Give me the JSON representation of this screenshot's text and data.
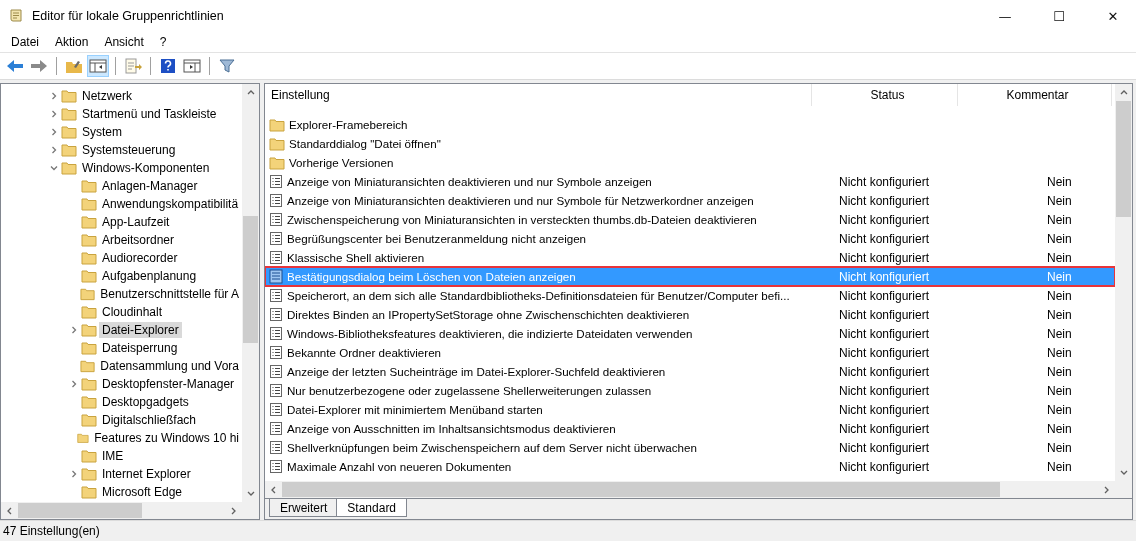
{
  "window": {
    "title": "Editor für lokale Gruppenrichtlinien",
    "controls": [
      "—",
      "☐",
      "✕"
    ]
  },
  "menu": [
    "Datei",
    "Aktion",
    "Ansicht",
    "?"
  ],
  "toolbar": [
    {
      "kind": "back",
      "pressed": false
    },
    {
      "kind": "forward",
      "pressed": false
    },
    {
      "kind": "sep"
    },
    {
      "kind": "folder-up",
      "pressed": false
    },
    {
      "kind": "tree-pane",
      "pressed": true
    },
    {
      "kind": "sep"
    },
    {
      "kind": "export",
      "pressed": false
    },
    {
      "kind": "sep"
    },
    {
      "kind": "help",
      "pressed": false
    },
    {
      "kind": "console",
      "pressed": false
    },
    {
      "kind": "sep"
    },
    {
      "kind": "filter",
      "pressed": false
    }
  ],
  "tree": [
    {
      "label": "Netzwerk",
      "has_children": true,
      "expanded": false,
      "selected": false
    },
    {
      "label": "Startmenü und Taskleiste",
      "has_children": true,
      "expanded": false,
      "selected": false
    },
    {
      "label": "System",
      "has_children": true,
      "expanded": false,
      "selected": false
    },
    {
      "label": "Systemsteuerung",
      "has_children": true,
      "expanded": false,
      "selected": false
    },
    {
      "label": "Windows-Komponenten",
      "has_children": true,
      "expanded": true,
      "selected": false,
      "children": [
        {
          "label": "Anlagen-Manager",
          "has_children": false,
          "selected": false
        },
        {
          "label": "Anwendungskompatibilitä",
          "has_children": false,
          "selected": false
        },
        {
          "label": "App-Laufzeit",
          "has_children": false,
          "selected": false
        },
        {
          "label": "Arbeitsordner",
          "has_children": false,
          "selected": false
        },
        {
          "label": "Audiorecorder",
          "has_children": false,
          "selected": false
        },
        {
          "label": "Aufgabenplanung",
          "has_children": false,
          "selected": false
        },
        {
          "label": "Benutzerschnittstelle für A",
          "has_children": false,
          "selected": false
        },
        {
          "label": "Cloudinhalt",
          "has_children": false,
          "selected": false
        },
        {
          "label": "Datei-Explorer",
          "has_children": true,
          "expanded": false,
          "selected": true
        },
        {
          "label": "Dateisperrung",
          "has_children": false,
          "selected": false
        },
        {
          "label": "Datensammlung und Vora",
          "has_children": false,
          "selected": false
        },
        {
          "label": "Desktopfenster-Manager",
          "has_children": true,
          "expanded": false,
          "selected": false
        },
        {
          "label": "Desktopgadgets",
          "has_children": false,
          "selected": false
        },
        {
          "label": "Digitalschließfach",
          "has_children": false,
          "selected": false
        },
        {
          "label": "Features zu Windows 10 hi",
          "has_children": false,
          "selected": false
        },
        {
          "label": "IME",
          "has_children": false,
          "selected": false
        },
        {
          "label": "Internet Explorer",
          "has_children": true,
          "expanded": false,
          "selected": false
        },
        {
          "label": "Microsoft Edge",
          "has_children": false,
          "selected": false
        }
      ]
    }
  ],
  "table": {
    "columns": [
      "Einstellung",
      "Status",
      "Kommentar"
    ],
    "rows": [
      {
        "kind": "folder",
        "name": "Explorer-Framebereich",
        "selected": false
      },
      {
        "kind": "folder",
        "name": "Standarddialog \"Datei öffnen\"",
        "selected": false
      },
      {
        "kind": "folder",
        "name": "Vorherige Versionen",
        "selected": false
      },
      {
        "kind": "setting",
        "name": "Anzeige von Miniaturansichten deaktivieren und nur Symbole anzeigen",
        "status": "Nicht konfiguriert",
        "comment": "Nein",
        "selected": false
      },
      {
        "kind": "setting",
        "name": "Anzeige von Miniaturansichten deaktivieren und nur Symbole für Netzwerkordner anzeigen",
        "status": "Nicht konfiguriert",
        "comment": "Nein",
        "selected": false
      },
      {
        "kind": "setting",
        "name": "Zwischenspeicherung von Miniaturansichten in versteckten thumbs.db-Dateien deaktivieren",
        "status": "Nicht konfiguriert",
        "comment": "Nein",
        "selected": false
      },
      {
        "kind": "setting",
        "name": "Begrüßungscenter bei Benutzeranmeldung nicht anzeigen",
        "status": "Nicht konfiguriert",
        "comment": "Nein",
        "selected": false
      },
      {
        "kind": "setting",
        "name": "Klassische Shell aktivieren",
        "status": "Nicht konfiguriert",
        "comment": "Nein",
        "selected": false
      },
      {
        "kind": "setting",
        "name": "Bestätigungsdialog beim Löschen von Dateien anzeigen",
        "status": "Nicht konfiguriert",
        "comment": "Nein",
        "selected": true
      },
      {
        "kind": "setting",
        "name": "Speicherort, an dem sich alle Standardbibliotheks-Definitionsdateien für Benutzer/Computer befi...",
        "status": "Nicht konfiguriert",
        "comment": "Nein",
        "selected": false
      },
      {
        "kind": "setting",
        "name": "Direktes Binden an IPropertySetStorage ohne Zwischenschichten deaktivieren",
        "status": "Nicht konfiguriert",
        "comment": "Nein",
        "selected": false
      },
      {
        "kind": "setting",
        "name": "Windows-Bibliotheksfeatures deaktivieren, die indizierte Dateidaten verwenden",
        "status": "Nicht konfiguriert",
        "comment": "Nein",
        "selected": false
      },
      {
        "kind": "setting",
        "name": "Bekannte Ordner deaktivieren",
        "status": "Nicht konfiguriert",
        "comment": "Nein",
        "selected": false
      },
      {
        "kind": "setting",
        "name": "Anzeige der letzten Sucheinträge im Datei-Explorer-Suchfeld deaktivieren",
        "status": "Nicht konfiguriert",
        "comment": "Nein",
        "selected": false
      },
      {
        "kind": "setting",
        "name": "Nur benutzerbezogene oder zugelassene Shellerweiterungen zulassen",
        "status": "Nicht konfiguriert",
        "comment": "Nein",
        "selected": false
      },
      {
        "kind": "setting",
        "name": "Datei-Explorer mit minimiertem Menüband starten",
        "status": "Nicht konfiguriert",
        "comment": "Nein",
        "selected": false
      },
      {
        "kind": "setting",
        "name": "Anzeige von Ausschnitten im Inhaltsansichtsmodus deaktivieren",
        "status": "Nicht konfiguriert",
        "comment": "Nein",
        "selected": false
      },
      {
        "kind": "setting",
        "name": "Shellverknüpfungen beim Zwischenspeichern auf dem Server nicht überwachen",
        "status": "Nicht konfiguriert",
        "comment": "Nein",
        "selected": false
      },
      {
        "kind": "setting",
        "name": "Maximale Anzahl von neueren Dokumenten",
        "status": "Nicht konfiguriert",
        "comment": "Nein",
        "selected": false
      }
    ]
  },
  "view_tabs": [
    {
      "label": "Erweitert",
      "selected": false
    },
    {
      "label": "Standard",
      "selected": true
    }
  ],
  "status_bar": "47 Einstellung(en)"
}
